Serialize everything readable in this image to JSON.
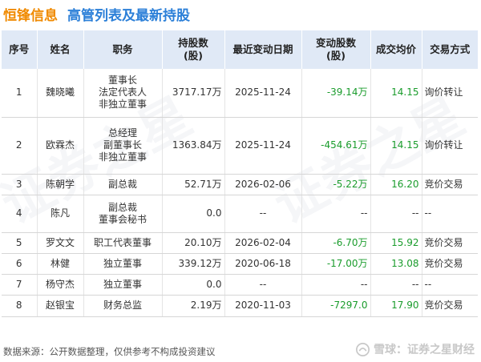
{
  "title": {
    "company": "恒锋信息",
    "text": "高管列表及最新持股"
  },
  "columns": [
    "序号",
    "姓名",
    "职务",
    "持股数(股)",
    "最近变动日期",
    "变动股数(股)",
    "成交均价",
    "交易方式"
  ],
  "column_lines": {
    "shares": [
      "持股数",
      "(股)"
    ],
    "change": [
      "变动股数",
      "(股)"
    ]
  },
  "rows": [
    {
      "no": "1",
      "name": "魏晓曦",
      "roles": [
        "董事长",
        "法定代表人",
        "非独立董事"
      ],
      "shares": "3717.17万",
      "date": "2025-11-24",
      "change": "-39.14万",
      "price": "14.15",
      "method": "询价转让"
    },
    {
      "no": "2",
      "name": "欧霖杰",
      "roles": [
        "总经理",
        "副董事长",
        "非独立董事"
      ],
      "shares": "1363.84万",
      "date": "2025-11-24",
      "change": "-454.61万",
      "price": "14.15",
      "method": "询价转让"
    },
    {
      "no": "3",
      "name": "陈朝学",
      "roles": [
        "副总裁"
      ],
      "shares": "52.71万",
      "date": "2026-02-06",
      "change": "-5.22万",
      "price": "16.20",
      "method": "竞价交易"
    },
    {
      "no": "4",
      "name": "陈凡",
      "roles": [
        "副总裁",
        "董事会秘书"
      ],
      "shares": "0.0",
      "date": "--",
      "change": "--",
      "price": "--",
      "method": "--"
    },
    {
      "no": "5",
      "name": "罗文文",
      "roles": [
        "职工代表董事"
      ],
      "shares": "20.10万",
      "date": "2026-02-04",
      "change": "-6.70万",
      "price": "15.92",
      "method": "竞价交易"
    },
    {
      "no": "6",
      "name": "林健",
      "roles": [
        "独立董事"
      ],
      "shares": "339.12万",
      "date": "2020-06-18",
      "change": "-17.00万",
      "price": "13.08",
      "method": "竞价交易"
    },
    {
      "no": "7",
      "name": "杨守杰",
      "roles": [
        "独立董事"
      ],
      "shares": "0.0",
      "date": "--",
      "change": "--",
      "price": "--",
      "method": "--"
    },
    {
      "no": "8",
      "name": "赵银宝",
      "roles": [
        "财务总监"
      ],
      "shares": "2.19万",
      "date": "2020-11-03",
      "change": "-7297.0",
      "price": "17.90",
      "method": "竞价交易"
    }
  ],
  "footer": "数据来源：公开数据整理，仅供参考不构成投资建议",
  "brand": "雪球：证券之星财经",
  "watermark": "证券之星",
  "colors": {
    "company": "#f08a00",
    "title": "#2b7fd8",
    "header_bg": "#e0e9f6",
    "value_green": "#1a9c2c"
  }
}
